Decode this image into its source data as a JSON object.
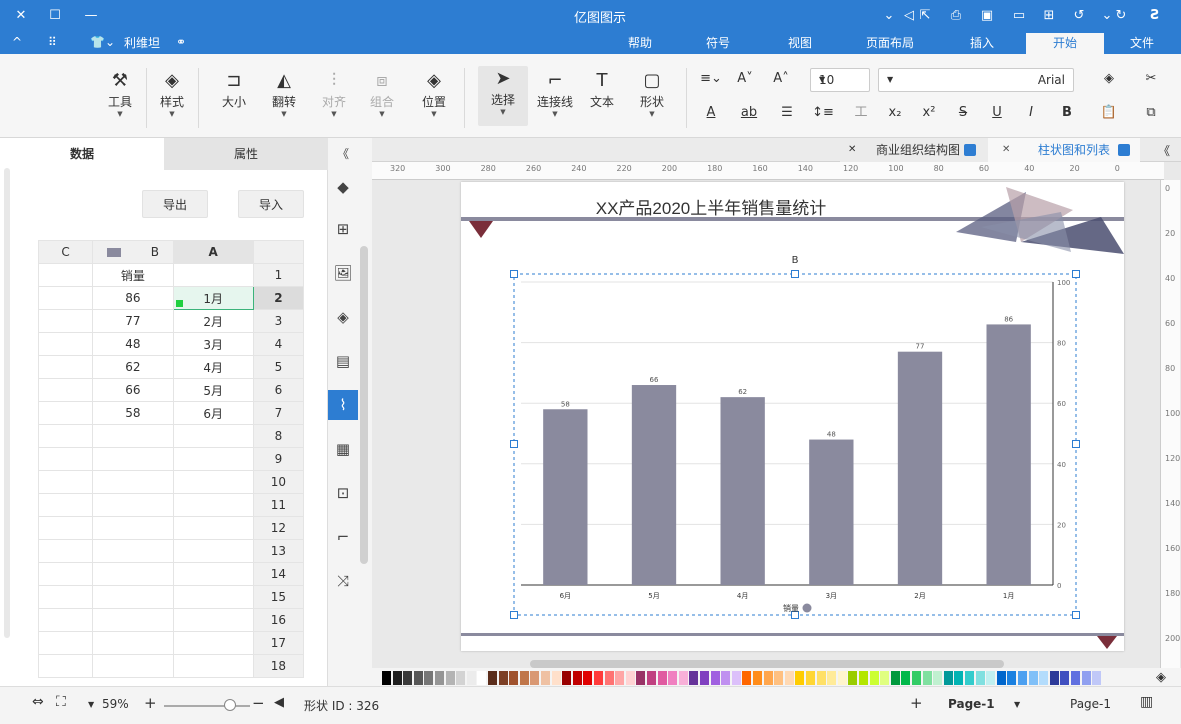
{
  "app": {
    "title": "亿图图示"
  },
  "titlebar": {
    "close_icon": "✕",
    "minimize_icon": "—"
  },
  "ribbon_tabs": {
    "tabs": [
      "文件",
      "开始",
      "插入",
      "页面布局",
      "视图",
      "符号",
      "帮助"
    ],
    "quick": [
      "利维坦"
    ]
  },
  "ribbon": {
    "tools_label": "工具",
    "style_label": "样式",
    "size_label": "大小",
    "flip_label": "翻转",
    "align_label": "对齐",
    "group_label": "组合",
    "position_label": "位置",
    "select_label": "选择",
    "connector_label": "连接线",
    "text_label": "文本",
    "shape_label": "形状",
    "font_size": "10",
    "font_name": "Arial"
  },
  "left_panel": {
    "tab_data": "数据",
    "tab_property": "属性",
    "import_label": "导入",
    "export_label": "导出",
    "columns": [
      "A",
      "B",
      "C"
    ],
    "rows": [
      {
        "n": "1",
        "a": "",
        "b": "销量",
        "c": ""
      },
      {
        "n": "2",
        "a": "1月",
        "b": "86",
        "c": ""
      },
      {
        "n": "3",
        "a": "2月",
        "b": "77",
        "c": ""
      },
      {
        "n": "4",
        "a": "3月",
        "b": "48",
        "c": ""
      },
      {
        "n": "5",
        "a": "4月",
        "b": "62",
        "c": ""
      },
      {
        "n": "6",
        "a": "5月",
        "b": "66",
        "c": ""
      },
      {
        "n": "7",
        "a": "6月",
        "b": "58",
        "c": ""
      },
      {
        "n": "8",
        "a": "",
        "b": "",
        "c": ""
      },
      {
        "n": "9",
        "a": "",
        "b": "",
        "c": ""
      },
      {
        "n": "10",
        "a": "",
        "b": "",
        "c": ""
      },
      {
        "n": "11",
        "a": "",
        "b": "",
        "c": ""
      },
      {
        "n": "12",
        "a": "",
        "b": "",
        "c": ""
      },
      {
        "n": "13",
        "a": "",
        "b": "",
        "c": ""
      },
      {
        "n": "14",
        "a": "",
        "b": "",
        "c": ""
      },
      {
        "n": "15",
        "a": "",
        "b": "",
        "c": ""
      },
      {
        "n": "16",
        "a": "",
        "b": "",
        "c": ""
      },
      {
        "n": "17",
        "a": "",
        "b": "",
        "c": ""
      },
      {
        "n": "18",
        "a": "",
        "b": "",
        "c": ""
      }
    ]
  },
  "doc_tabs": [
    "柱状图和列表",
    "商业组织结构图"
  ],
  "chart_title": "XX产品2020上半年销售量统计",
  "chart_data": {
    "type": "bar",
    "categories": [
      "1月",
      "2月",
      "3月",
      "4月",
      "5月",
      "6月"
    ],
    "series": [
      {
        "name": "销量",
        "values": [
          86,
          77,
          48,
          62,
          66,
          58
        ]
      }
    ],
    "ylim": [
      0,
      100
    ],
    "yticks": [
      0,
      20,
      40,
      60,
      80,
      100
    ],
    "bar_color": "#8a8a9e",
    "selected_label": "B",
    "legend": "bottom",
    "orientation_note": "mirrored"
  },
  "ruler": {
    "h_ticks": [
      "320",
      "300",
      "280",
      "260",
      "240",
      "220",
      "200",
      "180",
      "160",
      "140",
      "120",
      "100",
      "80",
      "60",
      "40",
      "20",
      "0"
    ],
    "v_ticks": [
      "0",
      "20",
      "40",
      "60",
      "80",
      "100",
      "120",
      "140",
      "160",
      "180",
      "200"
    ]
  },
  "status": {
    "page_tab": "Page-1",
    "page_select": "Page-1",
    "add_page": "+",
    "shape_id": "形状 ID : 326",
    "zoom": "59%"
  },
  "palette": [
    "#000000",
    "#1f1f1f",
    "#3a3a3a",
    "#575757",
    "#767676",
    "#959595",
    "#b4b4b4",
    "#d3d3d3",
    "#ececec",
    "#ffffff",
    "#5b2d1b",
    "#7d3f25",
    "#a0522d",
    "#c0764a",
    "#d99873",
    "#efc1a3",
    "#ffe0cb",
    "#990000",
    "#c00000",
    "#e00000",
    "#ff3b3b",
    "#ff7373",
    "#ffa6a6",
    "#ffd3d3",
    "#993366",
    "#c04080",
    "#e05aa0",
    "#f080c0",
    "#f8b0d8",
    "#663399",
    "#8040c0",
    "#a060e0",
    "#c090f0",
    "#dcc0fa",
    "#ff6600",
    "#ff8c1a",
    "#ffa64d",
    "#ffc080",
    "#ffd9b3",
    "#ffcc00",
    "#ffd633",
    "#ffe066",
    "#ffeb99",
    "#fff5cc",
    "#99cc00",
    "#b3e600",
    "#ccff33",
    "#e0ff80",
    "#00993d",
    "#00b84a",
    "#33cc66",
    "#80e0a0",
    "#c0f0d0",
    "#009999",
    "#00b3b3",
    "#33cccc",
    "#80e0e0",
    "#c0f0f0",
    "#0066cc",
    "#1a80e0",
    "#4da0f0",
    "#80c0f8",
    "#b3dcfc",
    "#2d3a99",
    "#4050c0",
    "#6070e0",
    "#90a0f0",
    "#c0c8f8"
  ]
}
